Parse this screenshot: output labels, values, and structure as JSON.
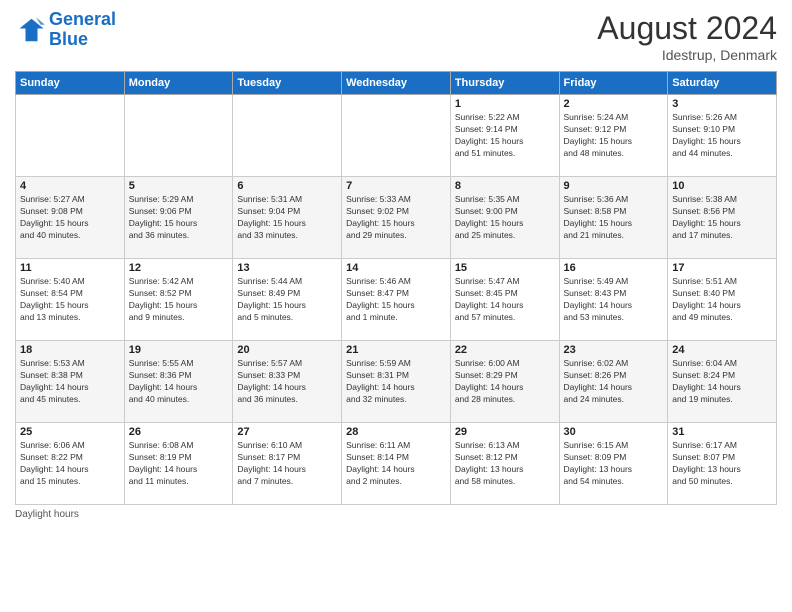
{
  "header": {
    "logo_line1": "General",
    "logo_line2": "Blue",
    "month_year": "August 2024",
    "location": "Idestrup, Denmark"
  },
  "footer": {
    "daylight_label": "Daylight hours"
  },
  "weekdays": [
    "Sunday",
    "Monday",
    "Tuesday",
    "Wednesday",
    "Thursday",
    "Friday",
    "Saturday"
  ],
  "weeks": [
    [
      {
        "day": "",
        "info": ""
      },
      {
        "day": "",
        "info": ""
      },
      {
        "day": "",
        "info": ""
      },
      {
        "day": "",
        "info": ""
      },
      {
        "day": "1",
        "info": "Sunrise: 5:22 AM\nSunset: 9:14 PM\nDaylight: 15 hours\nand 51 minutes."
      },
      {
        "day": "2",
        "info": "Sunrise: 5:24 AM\nSunset: 9:12 PM\nDaylight: 15 hours\nand 48 minutes."
      },
      {
        "day": "3",
        "info": "Sunrise: 5:26 AM\nSunset: 9:10 PM\nDaylight: 15 hours\nand 44 minutes."
      }
    ],
    [
      {
        "day": "4",
        "info": "Sunrise: 5:27 AM\nSunset: 9:08 PM\nDaylight: 15 hours\nand 40 minutes."
      },
      {
        "day": "5",
        "info": "Sunrise: 5:29 AM\nSunset: 9:06 PM\nDaylight: 15 hours\nand 36 minutes."
      },
      {
        "day": "6",
        "info": "Sunrise: 5:31 AM\nSunset: 9:04 PM\nDaylight: 15 hours\nand 33 minutes."
      },
      {
        "day": "7",
        "info": "Sunrise: 5:33 AM\nSunset: 9:02 PM\nDaylight: 15 hours\nand 29 minutes."
      },
      {
        "day": "8",
        "info": "Sunrise: 5:35 AM\nSunset: 9:00 PM\nDaylight: 15 hours\nand 25 minutes."
      },
      {
        "day": "9",
        "info": "Sunrise: 5:36 AM\nSunset: 8:58 PM\nDaylight: 15 hours\nand 21 minutes."
      },
      {
        "day": "10",
        "info": "Sunrise: 5:38 AM\nSunset: 8:56 PM\nDaylight: 15 hours\nand 17 minutes."
      }
    ],
    [
      {
        "day": "11",
        "info": "Sunrise: 5:40 AM\nSunset: 8:54 PM\nDaylight: 15 hours\nand 13 minutes."
      },
      {
        "day": "12",
        "info": "Sunrise: 5:42 AM\nSunset: 8:52 PM\nDaylight: 15 hours\nand 9 minutes."
      },
      {
        "day": "13",
        "info": "Sunrise: 5:44 AM\nSunset: 8:49 PM\nDaylight: 15 hours\nand 5 minutes."
      },
      {
        "day": "14",
        "info": "Sunrise: 5:46 AM\nSunset: 8:47 PM\nDaylight: 15 hours\nand 1 minute."
      },
      {
        "day": "15",
        "info": "Sunrise: 5:47 AM\nSunset: 8:45 PM\nDaylight: 14 hours\nand 57 minutes."
      },
      {
        "day": "16",
        "info": "Sunrise: 5:49 AM\nSunset: 8:43 PM\nDaylight: 14 hours\nand 53 minutes."
      },
      {
        "day": "17",
        "info": "Sunrise: 5:51 AM\nSunset: 8:40 PM\nDaylight: 14 hours\nand 49 minutes."
      }
    ],
    [
      {
        "day": "18",
        "info": "Sunrise: 5:53 AM\nSunset: 8:38 PM\nDaylight: 14 hours\nand 45 minutes."
      },
      {
        "day": "19",
        "info": "Sunrise: 5:55 AM\nSunset: 8:36 PM\nDaylight: 14 hours\nand 40 minutes."
      },
      {
        "day": "20",
        "info": "Sunrise: 5:57 AM\nSunset: 8:33 PM\nDaylight: 14 hours\nand 36 minutes."
      },
      {
        "day": "21",
        "info": "Sunrise: 5:59 AM\nSunset: 8:31 PM\nDaylight: 14 hours\nand 32 minutes."
      },
      {
        "day": "22",
        "info": "Sunrise: 6:00 AM\nSunset: 8:29 PM\nDaylight: 14 hours\nand 28 minutes."
      },
      {
        "day": "23",
        "info": "Sunrise: 6:02 AM\nSunset: 8:26 PM\nDaylight: 14 hours\nand 24 minutes."
      },
      {
        "day": "24",
        "info": "Sunrise: 6:04 AM\nSunset: 8:24 PM\nDaylight: 14 hours\nand 19 minutes."
      }
    ],
    [
      {
        "day": "25",
        "info": "Sunrise: 6:06 AM\nSunset: 8:22 PM\nDaylight: 14 hours\nand 15 minutes."
      },
      {
        "day": "26",
        "info": "Sunrise: 6:08 AM\nSunset: 8:19 PM\nDaylight: 14 hours\nand 11 minutes."
      },
      {
        "day": "27",
        "info": "Sunrise: 6:10 AM\nSunset: 8:17 PM\nDaylight: 14 hours\nand 7 minutes."
      },
      {
        "day": "28",
        "info": "Sunrise: 6:11 AM\nSunset: 8:14 PM\nDaylight: 14 hours\nand 2 minutes."
      },
      {
        "day": "29",
        "info": "Sunrise: 6:13 AM\nSunset: 8:12 PM\nDaylight: 13 hours\nand 58 minutes."
      },
      {
        "day": "30",
        "info": "Sunrise: 6:15 AM\nSunset: 8:09 PM\nDaylight: 13 hours\nand 54 minutes."
      },
      {
        "day": "31",
        "info": "Sunrise: 6:17 AM\nSunset: 8:07 PM\nDaylight: 13 hours\nand 50 minutes."
      }
    ]
  ]
}
